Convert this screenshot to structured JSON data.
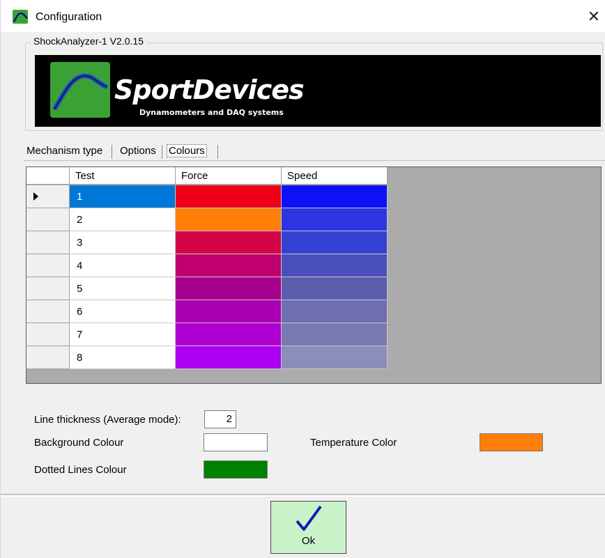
{
  "window": {
    "title": "Configuration",
    "close_glyph": "✕",
    "icon": "sportdevices-app-icon"
  },
  "group": {
    "legend": "ShockAnalyzer-1 V2.0.15",
    "logo": {
      "name": "SportDevices",
      "tagline": "Dynamometers and DAQ systems"
    }
  },
  "tabs": [
    {
      "label": "Mechanism type",
      "active": false
    },
    {
      "label": "Options",
      "active": false
    },
    {
      "label": "Colours",
      "active": true
    }
  ],
  "grid": {
    "columns": [
      "Test",
      "Force",
      "Speed"
    ],
    "selected_row": 0,
    "rows": [
      {
        "test": "1",
        "force": "#ee0019",
        "speed": "#0c12f4"
      },
      {
        "test": "2",
        "force": "#ff7f0a",
        "speed": "#2d35e1"
      },
      {
        "test": "3",
        "force": "#d40547",
        "speed": "#3541d2"
      },
      {
        "test": "4",
        "force": "#c0006c",
        "speed": "#4a4fbe"
      },
      {
        "test": "5",
        "force": "#a7008c",
        "speed": "#5b5eac"
      },
      {
        "test": "6",
        "force": "#aa00b2",
        "speed": "#6f6eb0"
      },
      {
        "test": "7",
        "force": "#ae00d1",
        "speed": "#7b79b1"
      },
      {
        "test": "8",
        "force": "#ad00f3",
        "speed": "#8d8db9"
      }
    ]
  },
  "options": {
    "line_thickness_label": "Line thickness (Average mode):",
    "line_thickness_value": "2",
    "background_colour_label": "Background Colour",
    "background_colour": "#ffffff",
    "temperature_color_label": "Temperature Color",
    "temperature_color": "#ff7f0a",
    "dotted_lines_label": "Dotted Lines Colour",
    "dotted_lines_colour": "#008000"
  },
  "ok_button": {
    "label": "Ok",
    "icon": "checkmark-icon"
  }
}
